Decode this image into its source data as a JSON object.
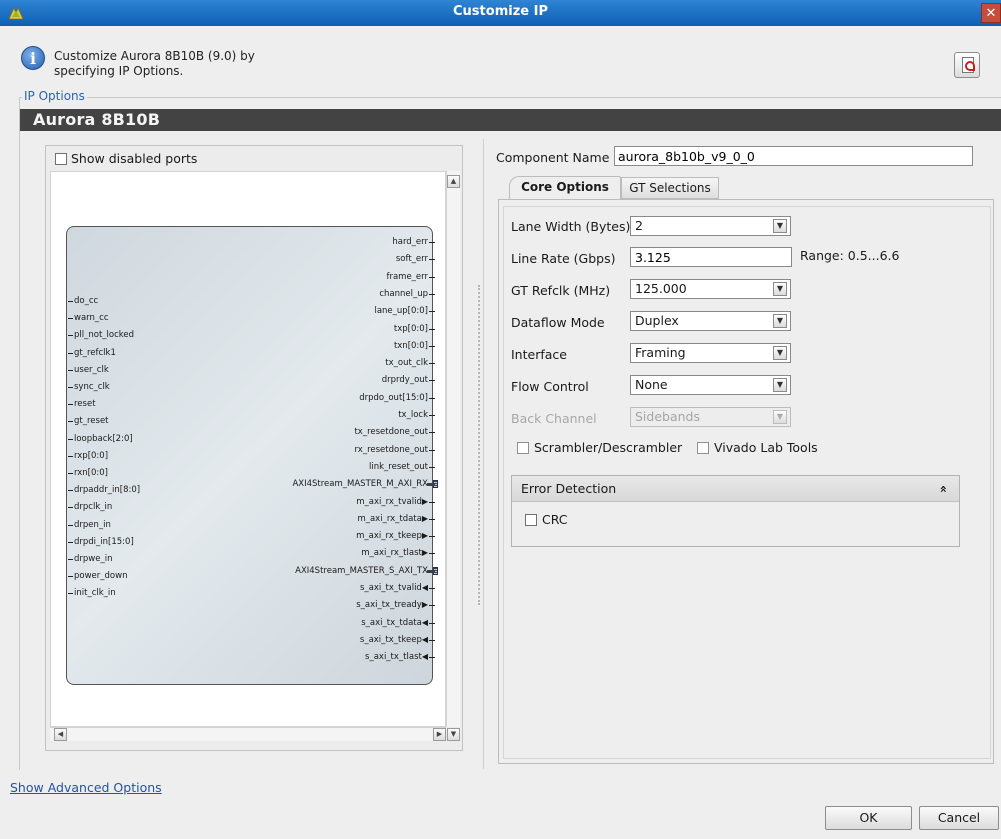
{
  "window": {
    "title": "Customize IP",
    "close_glyph": "✕"
  },
  "header": {
    "description": "Customize Aurora 8B10B (9.0) by specifying IP Options.",
    "info_icon": "info-icon",
    "pdf_icon": "pdf-doc-icon"
  },
  "ip_options": {
    "group_label": "IP Options",
    "ip_name": "Aurora 8B10B"
  },
  "diagram": {
    "show_disabled_ports": "Show disabled ports",
    "show_disabled_checked": false,
    "left_ports": [
      "do_cc",
      "warn_cc",
      "pll_not_locked",
      "gt_refclk1",
      "user_clk",
      "sync_clk",
      "reset",
      "gt_reset",
      "loopback[2:0]",
      "rxp[0:0]",
      "rxn[0:0]",
      "drpaddr_in[8:0]",
      "drpclk_in",
      "drpen_in",
      "drpdi_in[15:0]",
      "drpwe_in",
      "power_down",
      "init_clk_in"
    ],
    "right_ports": [
      {
        "name": "hard_err",
        "dir": ""
      },
      {
        "name": "soft_err",
        "dir": ""
      },
      {
        "name": "frame_err",
        "dir": ""
      },
      {
        "name": "channel_up",
        "dir": ""
      },
      {
        "name": "lane_up[0:0]",
        "dir": ""
      },
      {
        "name": "txp[0:0]",
        "dir": ""
      },
      {
        "name": "txn[0:0]",
        "dir": ""
      },
      {
        "name": "tx_out_clk",
        "dir": ""
      },
      {
        "name": "drprdy_out",
        "dir": ""
      },
      {
        "name": "drpdo_out[15:0]",
        "dir": ""
      },
      {
        "name": "tx_lock",
        "dir": ""
      },
      {
        "name": "tx_resetdone_out",
        "dir": ""
      },
      {
        "name": "rx_resetdone_out",
        "dir": ""
      },
      {
        "name": "link_reset_out",
        "dir": ""
      },
      {
        "name": "AXI4Stream_MASTER_M_AXI_RX",
        "dir": "bus"
      },
      {
        "name": "m_axi_rx_tvalid",
        "dir": "▶"
      },
      {
        "name": "m_axi_rx_tdata",
        "dir": "▶"
      },
      {
        "name": "m_axi_rx_tkeep",
        "dir": "▶"
      },
      {
        "name": "m_axi_rx_tlast",
        "dir": "▶"
      },
      {
        "name": "AXI4Stream_MASTER_S_AXI_TX",
        "dir": "bus"
      },
      {
        "name": "s_axi_tx_tvalid",
        "dir": "◀"
      },
      {
        "name": "s_axi_tx_tready",
        "dir": "▶"
      },
      {
        "name": "s_axi_tx_tdata",
        "dir": "◀"
      },
      {
        "name": "s_axi_tx_tkeep",
        "dir": "◀"
      },
      {
        "name": "s_axi_tx_tlast",
        "dir": "◀"
      }
    ]
  },
  "component": {
    "label": "Component Name",
    "value": "aurora_8b10b_v9_0_0"
  },
  "tabs": [
    {
      "label": "Core Options",
      "active": true
    },
    {
      "label": "GT Selections",
      "active": false
    }
  ],
  "core_options": {
    "lane_width": {
      "label": "Lane Width (Bytes)",
      "value": "2"
    },
    "line_rate": {
      "label": "Line Rate (Gbps)",
      "value": "3.125",
      "range": "Range: 0.5...6.6"
    },
    "gt_refclk": {
      "label": "GT Refclk (MHz)",
      "value": "125.000"
    },
    "dataflow_mode": {
      "label": "Dataflow Mode",
      "value": "Duplex"
    },
    "interface": {
      "label": "Interface",
      "value": "Framing"
    },
    "flow_control": {
      "label": "Flow Control",
      "value": "None"
    },
    "back_channel": {
      "label": "Back Channel",
      "value": "Sidebands",
      "disabled": true
    },
    "scrambler": {
      "label": "Scrambler/Descrambler",
      "checked": false
    },
    "vivado_lab_tools": {
      "label": "Vivado Lab Tools",
      "checked": false
    },
    "error_detection": {
      "title": "Error Detection",
      "collapse_glyph": "»",
      "crc": {
        "label": "CRC",
        "checked": false
      }
    }
  },
  "footer": {
    "advanced_link": "Show Advanced Options",
    "ok": "OK",
    "cancel": "Cancel"
  }
}
